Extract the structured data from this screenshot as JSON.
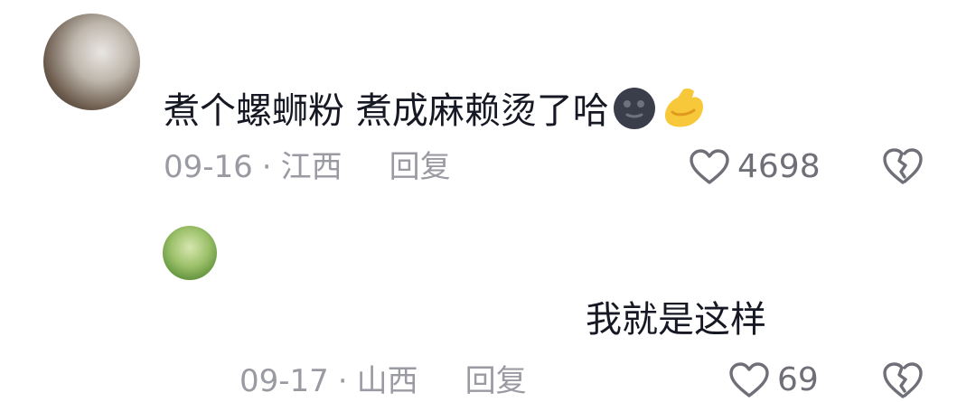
{
  "comments": [
    {
      "text": "煮个螺蛳粉 煮成麻赖烫了哈",
      "emojis": [
        "new-moon-face-emoji",
        "flexed-biceps-emoji"
      ],
      "date": "09-16",
      "location": "江西",
      "reply_label": "回复",
      "likes": "4698"
    },
    {
      "text": "我就是这样",
      "date": "09-17",
      "location": "山西",
      "reply_label": "回复",
      "likes": "69"
    }
  ],
  "separator": "·",
  "colors": {
    "text": "#161823",
    "meta": "#9a9aa2",
    "icon": "#6f6f78",
    "emoji_moon": "#3a3d4a",
    "emoji_arm": "#f7c83a"
  },
  "icons": {
    "like": "heart-outline-icon",
    "dislike": "broken-heart-icon"
  }
}
